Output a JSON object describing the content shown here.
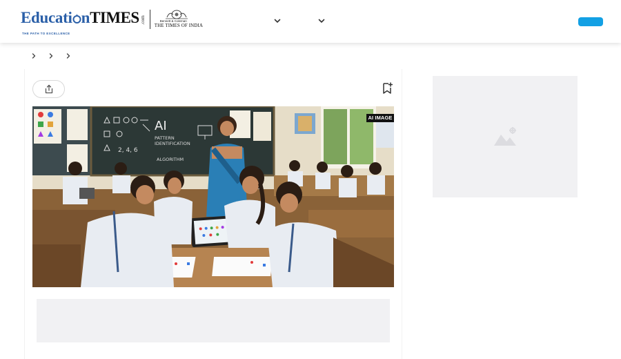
{
  "header": {
    "logo": {
      "brand_part1": "Educati",
      "brand_part2": "n",
      "brand_times": "TIMES",
      "dotcom": ".com",
      "tagline": "THE PATH TO EXCELLENCE",
      "partner_small": "Bennett & Coleman",
      "partner_name": "THE TIMES OF INDIA"
    },
    "nav_icons": [
      "chevron-down-icon",
      "chevron-down-icon"
    ],
    "cta_color": "#13a0e4"
  },
  "breadcrumb": {
    "separators": [
      "chevron-right-icon",
      "chevron-right-icon",
      "chevron-right-icon"
    ]
  },
  "article": {
    "share_icon": "share-icon",
    "bookmark_icon": "bookmark-add-icon",
    "hero_badge": "AI IMAGE",
    "hero_scene": {
      "blackboard_title": "AI",
      "blackboard_lines": [
        "PATTERN",
        "IDENTIFICATION",
        "ALGORITHM"
      ],
      "blackboard_sequence": "2, 4, 6"
    }
  },
  "sidebar": {
    "ad_placeholder_icon": "image-placeholder-icon"
  },
  "colors": {
    "brand_blue": "#2a5fa8",
    "accent": "#13a0e4",
    "placeholder_gray": "#f1f1f3"
  }
}
